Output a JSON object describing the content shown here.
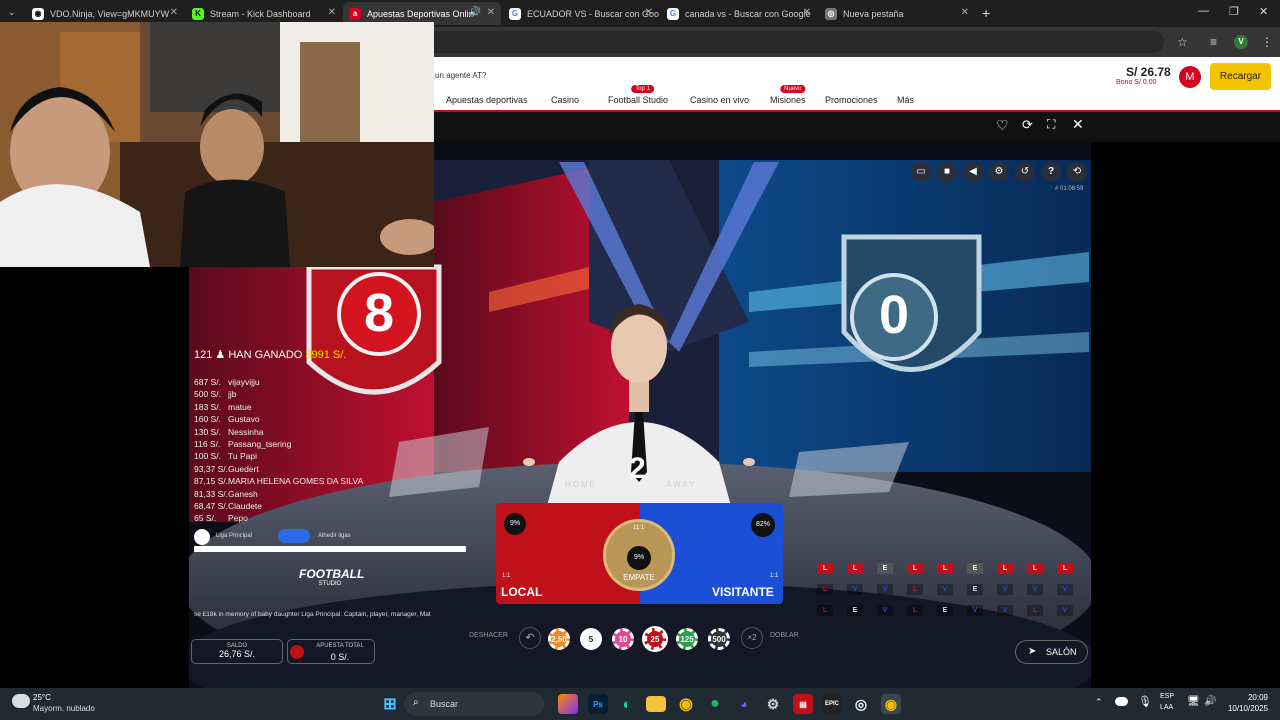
{
  "browser": {
    "tabs": [
      {
        "title": "VDO.Ninja, View=gMKMUYW",
        "icon": "vdo-ninja-icon"
      },
      {
        "title": "Stream - Kick Dashboard",
        "icon": "kick-icon"
      },
      {
        "title": "Apuestas Deportivas Onlin",
        "icon": "betting-site-icon"
      },
      {
        "title": "ECUADOR VS - Buscar con Goo",
        "icon": "google-icon"
      },
      {
        "title": "canada vs - Buscar con Google",
        "icon": "google-icon"
      },
      {
        "title": "Nueva pestaña",
        "icon": "chrome-icon"
      }
    ],
    "profile_initial": "V"
  },
  "site": {
    "promo_text": "un agente AT?",
    "nav": [
      "Apuestas deportivas",
      "Casino",
      "Football Studio",
      "Casino en vivo",
      "Misiones",
      "Promociones",
      "Más"
    ],
    "nav_badges": {
      "football_studio": "Top 1",
      "misiones": "Nuevo"
    },
    "balance": "S/ 26.78",
    "bonus": "Bono S/ 0.00",
    "avatar_initial": "M",
    "recharge_label": "Recargar"
  },
  "game": {
    "round_id": "# 01:08:59",
    "winners_header_count": "121",
    "winners_header_label": "HAN GANADO",
    "winners_total": "3991 S/.",
    "winners": [
      {
        "amount": "687 S/.",
        "name": "vijayvijju"
      },
      {
        "amount": "500 S/.",
        "name": "jjb"
      },
      {
        "amount": "183 S/.",
        "name": "matue"
      },
      {
        "amount": "160 S/.",
        "name": "Gustavo"
      },
      {
        "amount": "130 S/.",
        "name": "Nessinha"
      },
      {
        "amount": "116 S/.",
        "name": "Passang_tsering"
      },
      {
        "amount": "100 S/.",
        "name": "Tu Papi"
      },
      {
        "amount": "93,37 S/.",
        "name": "Guedert"
      },
      {
        "amount": "87,15 S/.",
        "name": "MARIA HELENA GOMES DA SILVA"
      },
      {
        "amount": "81,33 S/.",
        "name": "Ganesh"
      },
      {
        "amount": "68,47 S/.",
        "name": "Claudete"
      },
      {
        "amount": "65 S/.",
        "name": "Pepo"
      }
    ],
    "league_left": "Liga Principal",
    "league_right": "Alhedir ligas",
    "studio_logo_line1": "FOOTBALL",
    "studio_logo_line2": "STUDIO",
    "ticker": "se £18k in memory of baby daughter    Liga Principal: Captain, player, manager, Mat",
    "home_card": "8",
    "away_card": "0",
    "countdown": "2",
    "table_home": "HOME",
    "table_away": "AWAY",
    "local_pct": "9%",
    "visit_pct": "82%",
    "draw_pct": "9%",
    "local_label": "LOCAL",
    "visit_label": "VISITANTE",
    "draw_label": "EMPATE",
    "local_odds": "1:1",
    "visit_odds": "1:1",
    "draw_odds": "11:1",
    "undo_label": "DESHACER",
    "double_label": "DOBLAR",
    "chips": [
      "2,50",
      "5",
      "10",
      "25",
      "125",
      "500"
    ],
    "double_multiplier": "×2",
    "saldo_label": "SALDO",
    "saldo_value": "26,76 S/.",
    "apuesta_label": "APUESTA TOTAL",
    "apuesta_value": "0 S/.",
    "lobby_label": "SALÓN",
    "road_row1": [
      "L",
      "L",
      "E",
      "L",
      "L",
      "E",
      "L",
      "L",
      "L"
    ],
    "road_row2": [
      "L",
      "V",
      "V",
      "L",
      "V",
      "E",
      "V",
      "V",
      "V"
    ],
    "road_row3": [
      "L",
      "E",
      "V",
      "L",
      "E",
      "V",
      "V",
      "L",
      "V"
    ]
  },
  "taskbar": {
    "weather_temp": "25°C",
    "weather_desc": "Mayorm. nublado",
    "search_placeholder": "Buscar",
    "lang_line1": "ESP",
    "lang_line2": "LAA",
    "time": "20:09",
    "date": "10/10/2025"
  },
  "colors": {
    "brand_red": "#d7001f",
    "recharge_yellow": "#f5c400",
    "home_red": "#c0101a",
    "away_blue": "#1b4fd6"
  }
}
